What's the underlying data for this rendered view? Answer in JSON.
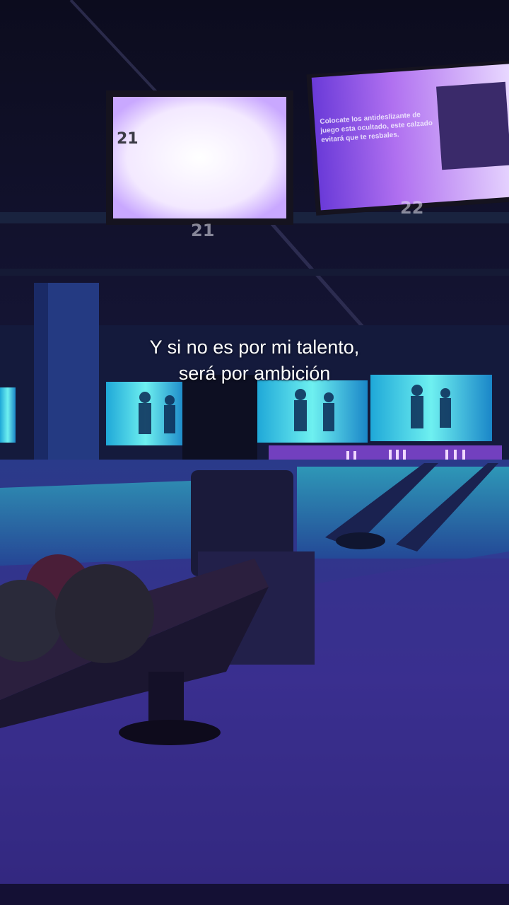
{
  "caption": {
    "line1": "Y si no es por mi talento,",
    "line2": "será por ambición"
  },
  "screens": {
    "left_number": "21",
    "right_text": "Colocate los antideslizante de juego esta ocultado, este calzado evitará que te resbales."
  },
  "lane_numbers": {
    "left": "21",
    "right": "22"
  },
  "colors": {
    "ambient": "#2a2470",
    "screen_glow": "#f2e6ff",
    "lane_cyan": "#47e0e0",
    "caption": "#ffffff"
  }
}
